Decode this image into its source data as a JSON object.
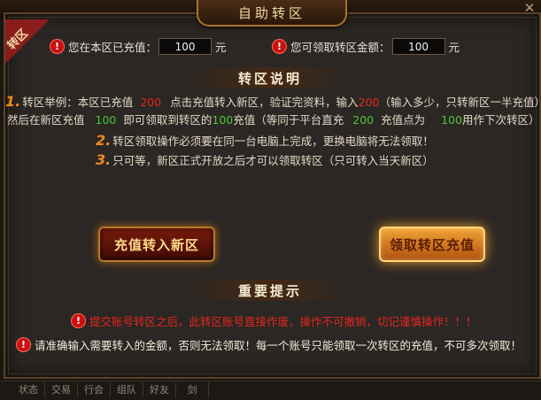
{
  "window": {
    "title": "自助转区",
    "close_icon": "close-icon"
  },
  "corner_badge": "转区",
  "recharge_row": {
    "label": "您在本区已充值：",
    "value": "100",
    "unit": "元"
  },
  "claim_row": {
    "label": "您可领取转区金额：",
    "value": "100",
    "unit": "元"
  },
  "explain": {
    "title": "转区说明",
    "item1": {
      "num": "1.",
      "line1_a": "转区举例：本区已充值",
      "line1_amount": "200",
      "line1_b": "点击充值转入新区，验证完资料，输入",
      "line1_amount2": "200",
      "line1_c": "（输入多少，只转新区一半充值）",
      "line2_a": "然后在新区充值",
      "line2_amount": "100",
      "line2_b": "即可领取到转区的",
      "line2_amount2": "100",
      "line2_c": "充值（等同于平台直充",
      "line2_amount3": "200",
      "line2_d": "充值点为",
      "line2_amount4": "100",
      "line2_e": "用作下次转区）"
    },
    "item2": {
      "num": "2.",
      "text": "转区领取操作必须要在同一台电脑上完成，更换电脑将无法领取！"
    },
    "item3": {
      "num": "3.",
      "text": "只可等，新区正式开放之后才可以领取转区（只可转入当天新区）"
    }
  },
  "buttons": {
    "recharge_transfer": "充值转入新区",
    "claim_recharge": "领取转区充值"
  },
  "notice": {
    "title": "重要提示",
    "line1": "提交账号转区之后，此转区账号直接作废，操作不可撤销，切记谨慎操作！！！",
    "line2": "请准确输入需要转入的金额，否则无法领取！每一个账号只能领取一次转区的充值，不可多次领取！"
  },
  "bottom_tabs": [
    "状态",
    "交易",
    "行会",
    "组队",
    "好友",
    "剑"
  ],
  "colors": {
    "accent_orange": "#f08a1d",
    "red": "#e5261d",
    "green": "#49c734"
  }
}
